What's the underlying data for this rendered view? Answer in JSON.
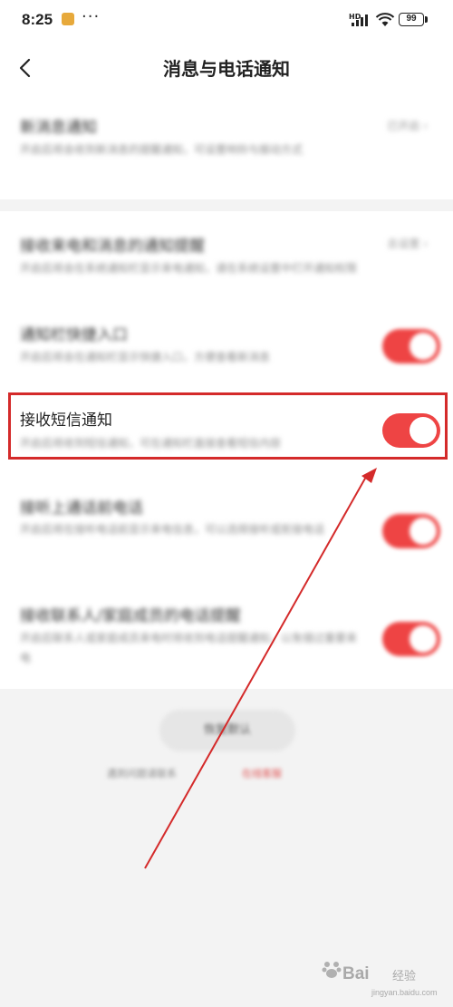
{
  "status_bar": {
    "time": "8:25",
    "more": "···",
    "network": "HD",
    "battery": "99",
    "icons": [
      "app-notification-icon",
      "signal-icon",
      "wifi-icon",
      "battery-icon"
    ]
  },
  "header": {
    "title": "消息与电话通知",
    "back_icon": "chevron-left-icon"
  },
  "sections": [
    {
      "rows": [
        {
          "title": "新消息通知",
          "description": "开启后将会收到新消息的提醒通知，可设置响铃与振动方式",
          "right_text": "已开启",
          "control": "chevron-right"
        }
      ]
    },
    {
      "rows": [
        {
          "title": "接收来电和消息的通知提醒",
          "description": "开启后将会在系统通知栏显示来电通知，请在系统设置中打开通知权限",
          "right_text": "去设置",
          "control": "chevron-right"
        },
        {
          "title": "通知栏快捷入口",
          "description": "开启后将会在通知栏显示快捷入口，方便查看新消息",
          "control": "toggle",
          "on": true
        },
        {
          "title": "接收短信通知",
          "description": "开启后将收到短信通知，可在通知栏直接查看短信内容",
          "control": "toggle",
          "on": true,
          "highlighted": true
        },
        {
          "title": "接听上通话前电话",
          "description": "开启后将在接听电话前显示来电信息，可以选择接听或拒接电话",
          "control": "toggle",
          "on": true
        },
        {
          "title": "接收联系人/家庭成员的电话提醒",
          "description": "开启后联系人或家庭成员来电时将收到电话提醒通知，以免错过重要来电",
          "control": "toggle",
          "on": true
        }
      ]
    }
  ],
  "footer": {
    "button_label": "恢复默认",
    "hint_text": "遇到问题请联系",
    "link_text": "在线客服"
  },
  "watermark": {
    "brand": "Bai",
    "brand_suffix": "经验",
    "url": "jingyan.baidu.com"
  },
  "colors": {
    "accent": "#ee4444",
    "highlight_border": "#d42a2a",
    "background": "#f3f3f3"
  }
}
